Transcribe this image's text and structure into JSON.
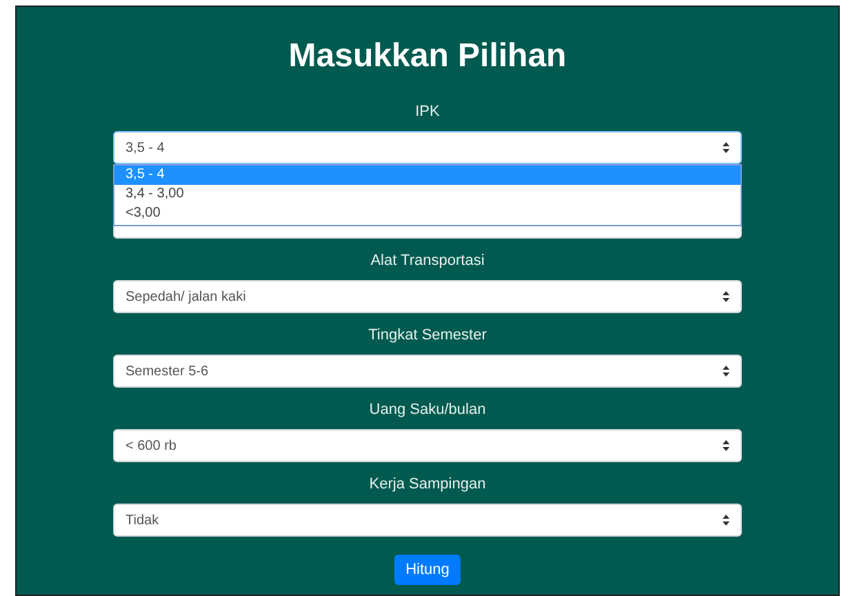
{
  "title": "Masukkan Pilihan",
  "fields": [
    {
      "label": "IPK",
      "value": "3,5 - 4",
      "open": true,
      "options": [
        {
          "label": "3,5 - 4",
          "selected": true
        },
        {
          "label": "3,4 - 3,00",
          "selected": false
        },
        {
          "label": "<3,00",
          "selected": false
        }
      ]
    },
    {
      "open": false
    },
    {
      "label": "Alat Transportasi",
      "value": "Sepedah/ jalan kaki",
      "open": false
    },
    {
      "label": "Tingkat Semester",
      "value": "Semester 5-6",
      "open": false
    },
    {
      "label": "Uang Saku/bulan",
      "value": "< 600 rb",
      "open": false
    },
    {
      "label": "Kerja Sampingan",
      "value": "Tidak",
      "open": false
    }
  ],
  "button": "Hitung"
}
